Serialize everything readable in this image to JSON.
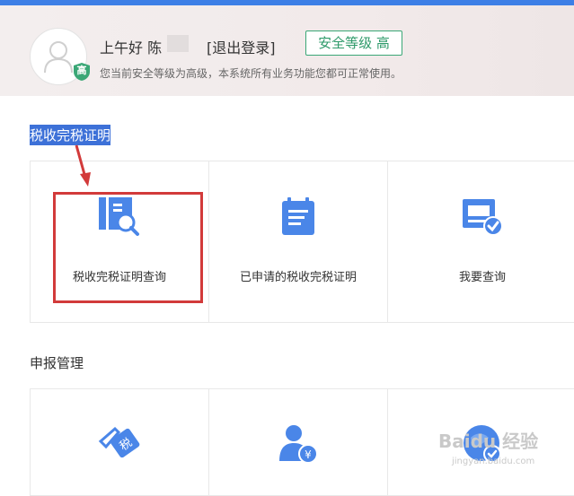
{
  "header": {
    "greeting": "上午好 陈",
    "logout_label": "[退出登录]",
    "level_badge": "安全等级 高",
    "shield_text": "高",
    "notice": "您当前安全等级为高级，本系统所有业务功能您都可正常使用。"
  },
  "section1": {
    "title": "税收完税证明",
    "items": [
      {
        "label": "税收完税证明查询",
        "icon": "document-search-icon"
      },
      {
        "label": "已申请的税收完税证明",
        "icon": "clipboard-list-icon"
      },
      {
        "label": "我要查询",
        "icon": "monitor-check-icon"
      }
    ]
  },
  "section2": {
    "title": "申报管理",
    "items": [
      {
        "label": "",
        "icon": "tax-tag-icon"
      },
      {
        "label": "",
        "icon": "user-yuan-icon"
      },
      {
        "label": "",
        "icon": "globe-check-icon"
      }
    ]
  },
  "watermark": {
    "text": "Baidu 经验",
    "sub": "jingyan.baidu.com"
  },
  "colors": {
    "accent": "#3d7fe6",
    "icon_blue": "#4a86e8",
    "badge_green": "#2e9a6a",
    "highlight_red": "#d23a3a"
  }
}
